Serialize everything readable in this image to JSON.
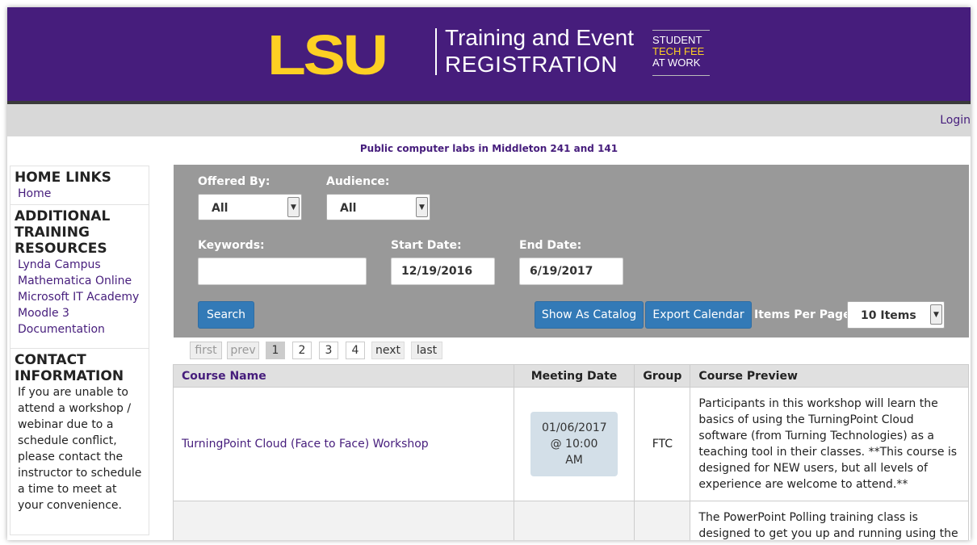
{
  "banner": {
    "logo": "LSU",
    "title_line1": "Training and Event",
    "title_line2": "REGISTRATION",
    "badge_line1": "STUDENT",
    "badge_line2": "TECH FEE",
    "badge_line3": "AT WORK",
    "colors": {
      "purple": "#461d7c",
      "gold": "#fdd023"
    }
  },
  "login_label": "Login",
  "notice": "Public computer labs in Middleton 241 and 141",
  "sidebar": {
    "home_heading": "HOME LINKS",
    "home_links": [
      "Home"
    ],
    "resources_heading": "ADDITIONAL TRAINING RESOURCES",
    "resources_links": [
      "Lynda Campus",
      "Mathematica Online",
      "Microsoft IT Academy",
      "Moodle 3",
      "Documentation"
    ],
    "contact_heading": "CONTACT INFORMATION",
    "contact_text": "If you are unable to attend a workshop / webinar due to a schedule conflict, please contact the instructor to schedule a time to meet at your convenience."
  },
  "filters": {
    "offered_by_label": "Offered By:",
    "offered_by_value": "All",
    "audience_label": "Audience:",
    "audience_value": "All",
    "keywords_label": "Keywords:",
    "keywords_value": "",
    "start_date_label": "Start Date:",
    "start_date_value": "12/19/2016",
    "end_date_label": "End Date:",
    "end_date_value": "6/19/2017",
    "search_button": "Search",
    "catalog_button": "Show As Catalog",
    "export_button": "Export Calendar",
    "items_per_page_label": "Items Per Page:",
    "items_per_page_value": "10 Items"
  },
  "pager": {
    "first": "first",
    "prev": "prev",
    "pages": [
      "1",
      "2",
      "3",
      "4"
    ],
    "current_page": "1",
    "next": "next",
    "last": "last"
  },
  "table": {
    "headers": [
      "Course Name",
      "Meeting Date",
      "Group",
      "Course Preview"
    ],
    "rows": [
      {
        "course": "TurningPoint Cloud (Face to Face) Workshop",
        "date_line1": "01/06/2017",
        "date_line2": "@ 10:00 AM",
        "group": "FTC",
        "preview": "Participants in this workshop will learn the basics of using the TurningPoint Cloud software (from Turning Technologies) as a teaching tool in their classes. **This course is designed for NEW users, but all levels of experience are welcome to attend.**"
      },
      {
        "course": "",
        "date_line1": "",
        "date_line2": "",
        "group": "",
        "preview": "The PowerPoint Polling training class is designed to get you up and running using the direct"
      }
    ]
  }
}
